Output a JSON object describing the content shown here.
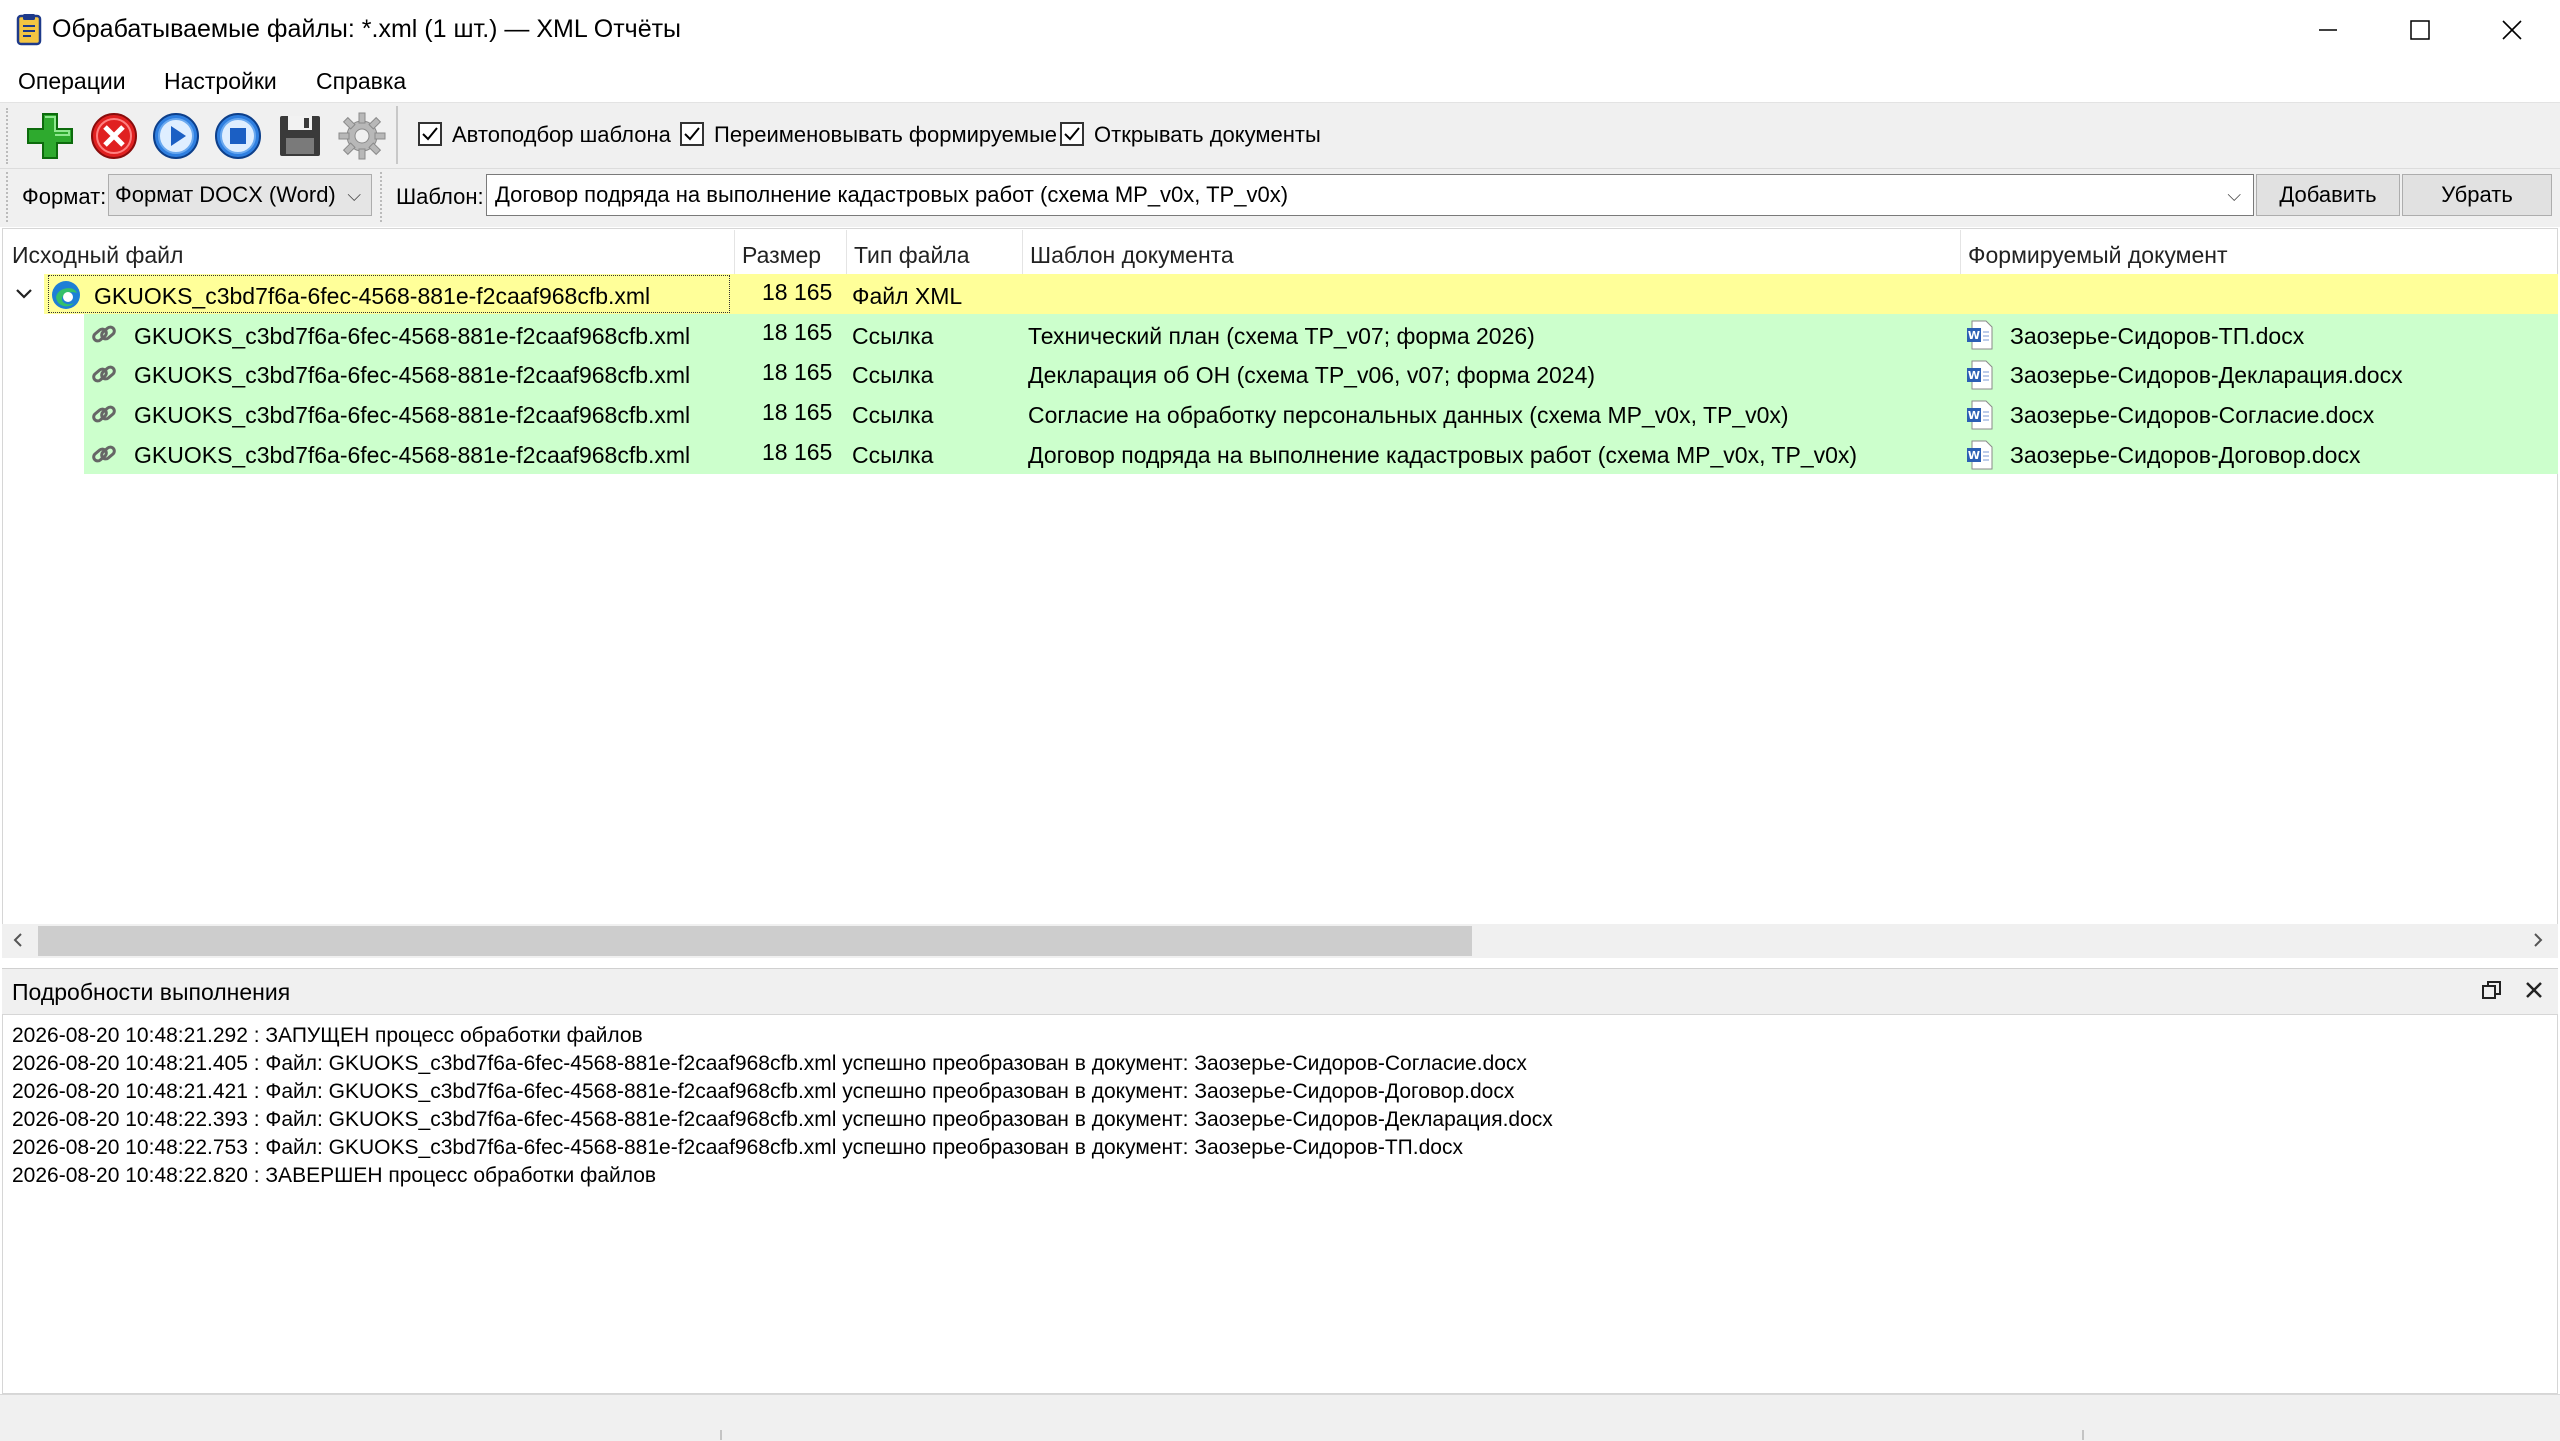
{
  "window": {
    "title": "Обрабатываемые файлы: *.xml (1 шт.) — XML Отчёты"
  },
  "menu": [
    "Операции",
    "Настройки",
    "Справка"
  ],
  "toolbar": {
    "checkboxes": [
      {
        "label": "Автоподбор шаблона",
        "checked": true
      },
      {
        "label": "Переименовывать формируемые",
        "checked": true
      },
      {
        "label": "Открывать документы",
        "checked": true
      }
    ]
  },
  "formatbar": {
    "format_label": "Формат:",
    "format_value": "Формат DOCX (Word)",
    "template_label": "Шаблон:",
    "template_value": "Договор подряда на выполнение кадастровых работ (схема MP_v0x, TP_v0x)",
    "add_label": "Добавить",
    "remove_label": "Убрать"
  },
  "table": {
    "columns": [
      "Исходный файл",
      "Размер",
      "Тип файла",
      "Шаблон документа",
      "Формируемый документ"
    ],
    "root": {
      "name": "GKUOKS_c3bd7f6a-6fec-4568-881e-f2caaf968cfb.xml",
      "size": "18 165",
      "type": "Файл XML",
      "template": "",
      "output": ""
    },
    "children": [
      {
        "name": "GKUOKS_c3bd7f6a-6fec-4568-881e-f2caaf968cfb.xml",
        "size": "18 165",
        "type": "Ссылка",
        "template": "Технический план (схема TP_v07; форма 2026)",
        "output": "Заозерье-Сидоров-ТП.docx"
      },
      {
        "name": "GKUOKS_c3bd7f6a-6fec-4568-881e-f2caaf968cfb.xml",
        "size": "18 165",
        "type": "Ссылка",
        "template": "Декларация об ОН (схема TP_v06, v07; форма 2024)",
        "output": "Заозерье-Сидоров-Декларация.docx"
      },
      {
        "name": "GKUOKS_c3bd7f6a-6fec-4568-881e-f2caaf968cfb.xml",
        "size": "18 165",
        "type": "Ссылка",
        "template": "Согласие на обработку персональных данных (схема MP_v0x, TP_v0x)",
        "output": "Заозерье-Сидоров-Согласие.docx"
      },
      {
        "name": "GKUOKS_c3bd7f6a-6fec-4568-881e-f2caaf968cfb.xml",
        "size": "18 165",
        "type": "Ссылка",
        "template": "Договор подряда на выполнение кадастровых работ (схема MP_v0x, TP_v0x)",
        "output": "Заозерье-Сидоров-Договор.docx"
      }
    ]
  },
  "details": {
    "title": "Подробности выполнения",
    "log": [
      "2026-08-20 10:48:21.292 : ЗАПУЩЕН процесс обработки файлов",
      "2026-08-20 10:48:21.405 : Файл: GKUOKS_c3bd7f6a-6fec-4568-881e-f2caaf968cfb.xml успешно преобразован в документ: Заозерье-Сидоров-Согласие.docx",
      "2026-08-20 10:48:21.421 : Файл: GKUOKS_c3bd7f6a-6fec-4568-881e-f2caaf968cfb.xml успешно преобразован в документ: Заозерье-Сидоров-Договор.docx",
      "2026-08-20 10:48:22.393 : Файл: GKUOKS_c3bd7f6a-6fec-4568-881e-f2caaf968cfb.xml успешно преобразован в документ: Заозерье-Сидоров-Декларация.docx",
      "2026-08-20 10:48:22.753 : Файл: GKUOKS_c3bd7f6a-6fec-4568-881e-f2caaf968cfb.xml успешно преобразован в документ: Заозерье-Сидоров-ТП.docx",
      "2026-08-20 10:48:22.820 : ЗАВЕРШЕН процесс обработки файлов"
    ]
  },
  "colors": {
    "root_row": "#ffff99",
    "child_row": "#ccffcc",
    "toolbar_bg": "#f0f0f0"
  },
  "icons": [
    "app-icon",
    "add-icon",
    "delete-icon",
    "run-icon",
    "stop-icon",
    "save-icon",
    "settings-icon",
    "xml-file-icon",
    "link-icon",
    "word-doc-icon"
  ]
}
